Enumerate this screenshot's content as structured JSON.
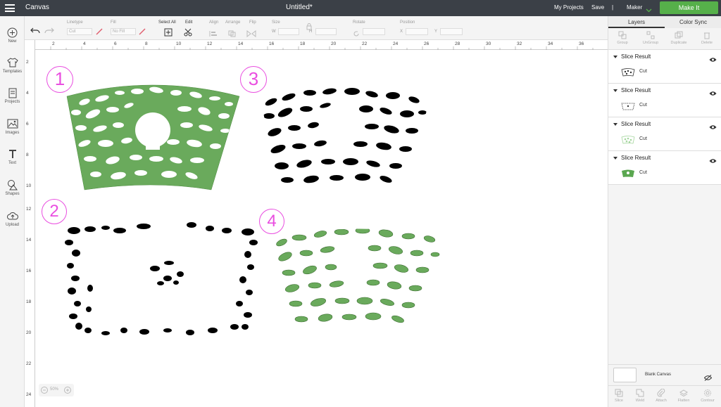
{
  "topbar": {
    "app_name": "Canvas",
    "doc_title": "Untitled*",
    "my_projects": "My Projects",
    "save": "Save",
    "divider": "|",
    "machine": "Maker",
    "make_it": "Make It"
  },
  "toolbar": {
    "linetype_label": "Linetype",
    "linetype_value": "Cut",
    "fill_label": "Fill",
    "fill_value": "No Fill",
    "select_all": "Select All",
    "edit": "Edit",
    "align": "Align",
    "arrange": "Arrange",
    "flip": "Flip",
    "size": "Size",
    "w": "W",
    "h": "H",
    "rotate": "Rotate",
    "position": "Position",
    "x": "X",
    "y": "Y"
  },
  "leftbar": [
    {
      "label": "New",
      "icon": "plus-circle-icon"
    },
    {
      "label": "Templates",
      "icon": "tshirt-icon"
    },
    {
      "label": "Projects",
      "icon": "projects-icon"
    },
    {
      "label": "Images",
      "icon": "image-icon"
    },
    {
      "label": "Text",
      "icon": "text-icon"
    },
    {
      "label": "Shapes",
      "icon": "shapes-icon"
    },
    {
      "label": "Upload",
      "icon": "upload-icon"
    }
  ],
  "ruler": {
    "top": [
      "2",
      "4",
      "6",
      "8",
      "10",
      "12",
      "14",
      "16",
      "18",
      "20",
      "22",
      "24",
      "26",
      "28",
      "30",
      "32",
      "34",
      "36"
    ],
    "left": [
      "2",
      "4",
      "6",
      "8",
      "10",
      "12",
      "14",
      "16",
      "18",
      "20",
      "22",
      "24"
    ]
  },
  "canvas": {
    "badges": [
      "1",
      "3",
      "2",
      "4"
    ],
    "zoom": "50%"
  },
  "panel": {
    "tabs": [
      "Layers",
      "Color Sync"
    ],
    "actions": [
      "Group",
      "UnGroup",
      "Duplicate",
      "Delete"
    ],
    "layers": [
      {
        "title": "Slice Result",
        "op": "Cut",
        "thumb_color": "#ffffff"
      },
      {
        "title": "Slice Result",
        "op": "Cut",
        "thumb_color": "#ffffff"
      },
      {
        "title": "Slice Result",
        "op": "Cut",
        "thumb_color": "#a5d69e"
      },
      {
        "title": "Slice Result",
        "op": "Cut",
        "thumb_color": "#5aa750"
      }
    ],
    "blank_canvas": "Blank Canvas",
    "bottom_tools": [
      "Slice",
      "Weld",
      "Attach",
      "Flatten",
      "Contour"
    ]
  },
  "colors": {
    "accent_green": "#56b04a",
    "shape_green": "#6aaa5c",
    "badge_pink": "#e94ee0",
    "topbar": "#3b4047"
  }
}
